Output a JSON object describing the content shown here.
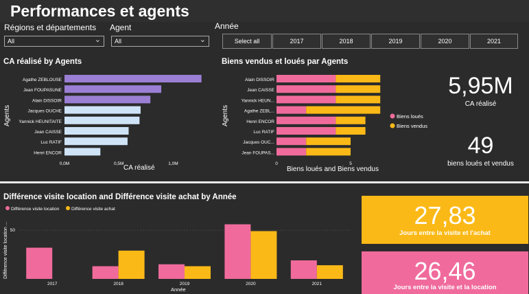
{
  "header": {
    "title": "Performances et agents"
  },
  "filters": {
    "regions": {
      "label": "Régions et départements",
      "value": "All"
    },
    "agent": {
      "label": "Agent",
      "value": "All"
    },
    "annee": {
      "label": "Année",
      "buttons": [
        "Select all",
        "2017",
        "2018",
        "2019",
        "2020",
        "2021"
      ]
    }
  },
  "kpis": {
    "ca": {
      "value": "5,95M",
      "label": "CA réalisé"
    },
    "biens": {
      "value": "49",
      "label": "biens loués et vendus"
    }
  },
  "cards": {
    "achat": {
      "value": "27,83",
      "label": "Jours entre la visite et l'achat",
      "color": "#fbb917"
    },
    "location": {
      "value": "26,46",
      "label": "Jours entre la visite et la location",
      "color": "#f06b9c"
    }
  },
  "chart_data": [
    {
      "id": "ca",
      "type": "bar",
      "title": "CA réalisé by Agents",
      "xlabel": "CA réalisé",
      "ylabel": "Agents",
      "categories": [
        "Agathe ZEBLOUSE",
        "Jean FOUPASUNE",
        "Alain DISSOIR",
        "Jacques OUCHE",
        "Yannick HEUNITAITE",
        "Jean CAISSE",
        "Luc RATIF",
        "Henri ENCOR"
      ],
      "values": [
        1.26,
        0.89,
        0.79,
        0.7,
        0.69,
        0.59,
        0.58,
        0.33
      ],
      "colors": [
        "#9b7fd4",
        "#9b7fd4",
        "#9b7fd4",
        "#cfe3f7",
        "#cfe3f7",
        "#cfe3f7",
        "#cfe3f7",
        "#cfe3f7"
      ],
      "xticks": [
        "0,0M",
        "0,5M",
        "1,0M"
      ],
      "xlim": [
        0,
        1.3
      ]
    },
    {
      "id": "biens",
      "type": "bar",
      "title": "Biens vendus et loués par Agents",
      "xlabel": "Biens loués and Biens vendus",
      "ylabel": "Agents",
      "categories": [
        "Alain DISSOIR",
        "Jean CAISSE",
        "Yannick HEUN...",
        "Agathe ZEBL...",
        "Henri ENCOR",
        "Luc RATIF",
        "Jacques OUC...",
        "Jean FOUPAS..."
      ],
      "series": [
        {
          "name": "Biens loués",
          "color": "#f06b9c",
          "values": [
            4,
            4,
            4,
            2,
            4,
            4,
            2,
            2
          ]
        },
        {
          "name": "Biens vendus",
          "color": "#fbb917",
          "values": [
            3,
            3,
            3,
            5,
            2,
            2,
            3,
            3
          ]
        }
      ],
      "xticks": [
        "0",
        "5"
      ],
      "xlim": [
        0,
        7.5
      ]
    },
    {
      "id": "diff",
      "type": "bar",
      "title": "Différence visite location and Différence visite achat by Année",
      "xlabel": "Année",
      "ylabel": "Différence visite location ...",
      "categories": [
        "2017",
        "2018",
        "2019",
        "2020",
        "2021"
      ],
      "series": [
        {
          "name": "Différence visite location",
          "color": "#f06b9c",
          "values": [
            32,
            13,
            15,
            56,
            19
          ]
        },
        {
          "name": "Différence visite achat",
          "color": "#fbb917",
          "values": [
            0,
            29,
            13,
            49,
            14
          ]
        }
      ],
      "yticks": [
        "50"
      ],
      "ylim": [
        0,
        62
      ]
    }
  ]
}
